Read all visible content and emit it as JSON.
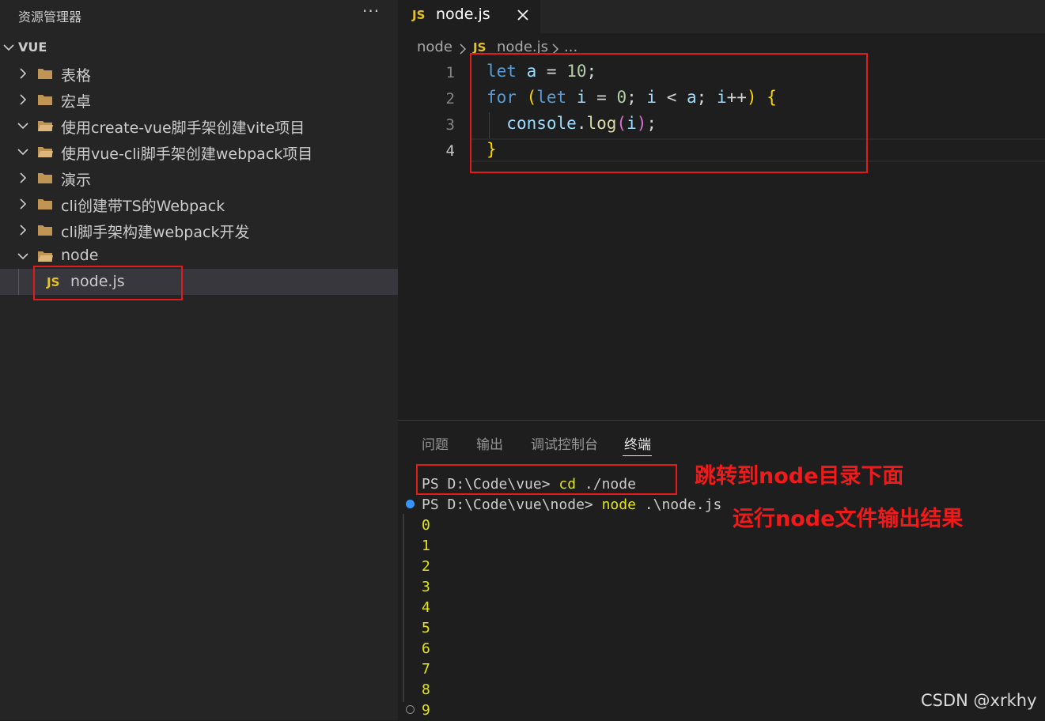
{
  "sidebar": {
    "title": "资源管理器",
    "more": "···",
    "root": "VUE",
    "items": [
      {
        "label": "表格",
        "expanded": false
      },
      {
        "label": "宏卓",
        "expanded": false
      },
      {
        "label": "使用create-vue脚手架创建vite项目",
        "expanded": true
      },
      {
        "label": "使用vue-cli脚手架创建webpack项目",
        "expanded": true
      },
      {
        "label": "演示",
        "expanded": false
      },
      {
        "label": "cli创建带TS的Webpack",
        "expanded": false
      },
      {
        "label": "cli脚手架构建webpack开发",
        "expanded": false
      },
      {
        "label": "node",
        "expanded": true
      }
    ],
    "file": {
      "icon": "JS",
      "label": "node.js"
    }
  },
  "tabs": [
    {
      "icon": "JS",
      "label": "node.js"
    }
  ],
  "breadcrumb": {
    "folder": "node",
    "icon": "JS",
    "file": "node.js",
    "more": "..."
  },
  "editor": {
    "line_numbers": [
      "1",
      "2",
      "3",
      "4"
    ],
    "active_line": 4,
    "lines": [
      [
        {
          "t": "let",
          "c": "kw"
        },
        {
          "t": " ",
          "c": "op"
        },
        {
          "t": "a",
          "c": "var"
        },
        {
          "t": " = ",
          "c": "op"
        },
        {
          "t": "10",
          "c": "num"
        },
        {
          "t": ";",
          "c": "op"
        }
      ],
      [
        {
          "t": "for",
          "c": "kw"
        },
        {
          "t": " ",
          "c": "op"
        },
        {
          "t": "(",
          "c": "br1"
        },
        {
          "t": "let",
          "c": "kw"
        },
        {
          "t": " ",
          "c": "op"
        },
        {
          "t": "i",
          "c": "var"
        },
        {
          "t": " = ",
          "c": "op"
        },
        {
          "t": "0",
          "c": "num"
        },
        {
          "t": "; ",
          "c": "op"
        },
        {
          "t": "i",
          "c": "var"
        },
        {
          "t": " < ",
          "c": "op"
        },
        {
          "t": "a",
          "c": "var"
        },
        {
          "t": "; ",
          "c": "op"
        },
        {
          "t": "i",
          "c": "var"
        },
        {
          "t": "++",
          "c": "op"
        },
        {
          "t": ")",
          "c": "br1"
        },
        {
          "t": " ",
          "c": "op"
        },
        {
          "t": "{",
          "c": "br1"
        }
      ],
      [
        {
          "t": "  ",
          "c": "op"
        },
        {
          "t": "console",
          "c": "var"
        },
        {
          "t": ".",
          "c": "op"
        },
        {
          "t": "log",
          "c": "fn"
        },
        {
          "t": "(",
          "c": "br2"
        },
        {
          "t": "i",
          "c": "var"
        },
        {
          "t": ")",
          "c": "br2"
        },
        {
          "t": ";",
          "c": "op"
        }
      ],
      [
        {
          "t": "}",
          "c": "br1"
        }
      ]
    ]
  },
  "panel": {
    "tabs": [
      "问题",
      "输出",
      "调试控制台",
      "终端"
    ],
    "active_tab": "终端",
    "terminal": {
      "line1": {
        "prompt": "PS D:\\Code\\vue> ",
        "cmd": "cd",
        "args": " ./node"
      },
      "line2": {
        "prompt": "PS D:\\Code\\vue\\node> ",
        "cmd": "node",
        "args": " .\\node.js"
      },
      "output": [
        "0",
        "1",
        "2",
        "3",
        "4",
        "5",
        "6",
        "7",
        "8",
        "9"
      ]
    }
  },
  "annotations": {
    "cd_note": "跳转到node目录下面",
    "run_note": "运行node文件输出结果",
    "color": "#e21b1b"
  },
  "watermark": "CSDN @xrkhy"
}
